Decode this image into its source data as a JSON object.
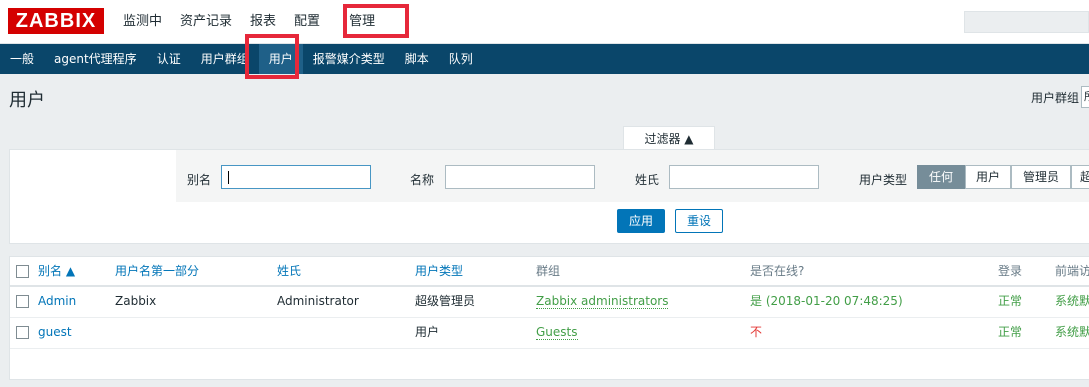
{
  "topbar": {
    "logo": "ZABBIX",
    "nav": [
      "监测中",
      "资产记录",
      "报表",
      "配置",
      "管理"
    ]
  },
  "subnav": [
    "一般",
    "agent代理程序",
    "认证",
    "用户群组",
    "用户",
    "报警媒介类型",
    "脚本",
    "队列"
  ],
  "page": {
    "title": "用户",
    "group_label": "用户群组",
    "group_select_value": "所"
  },
  "filter": {
    "tab_label": "过滤器 ▲",
    "alias_label": "别名",
    "alias_value": "",
    "name_label": "名称",
    "name_value": "",
    "surname_label": "姓氏",
    "surname_value": "",
    "type_label": "用户类型",
    "type_options": [
      "任何",
      "用户",
      "管理员",
      "超"
    ],
    "apply": "应用",
    "reset": "重设"
  },
  "table": {
    "headers": [
      "别名 ▲",
      "用户名第一部分",
      "姓氏",
      "用户类型",
      "群组",
      "是否在线?",
      "登录",
      "前端访"
    ],
    "rows": [
      {
        "alias": "Admin",
        "name": "Zabbix",
        "surname": "Administrator",
        "type": "超级管理员",
        "group": "Zabbix administrators",
        "online": "是 (2018-01-20 07:48:25)",
        "login": "正常",
        "frontend": "系统默"
      },
      {
        "alias": "guest",
        "name": "",
        "surname": "",
        "type": "用户",
        "group": "Guests",
        "online": "不",
        "login": "正常",
        "frontend": "系统默"
      }
    ]
  },
  "colors": {
    "accent": "#0275b8",
    "nav_bg": "#0a466a",
    "highlight": "#e6283a",
    "ok_green": "#429e47",
    "logo_red": "#d40000"
  }
}
